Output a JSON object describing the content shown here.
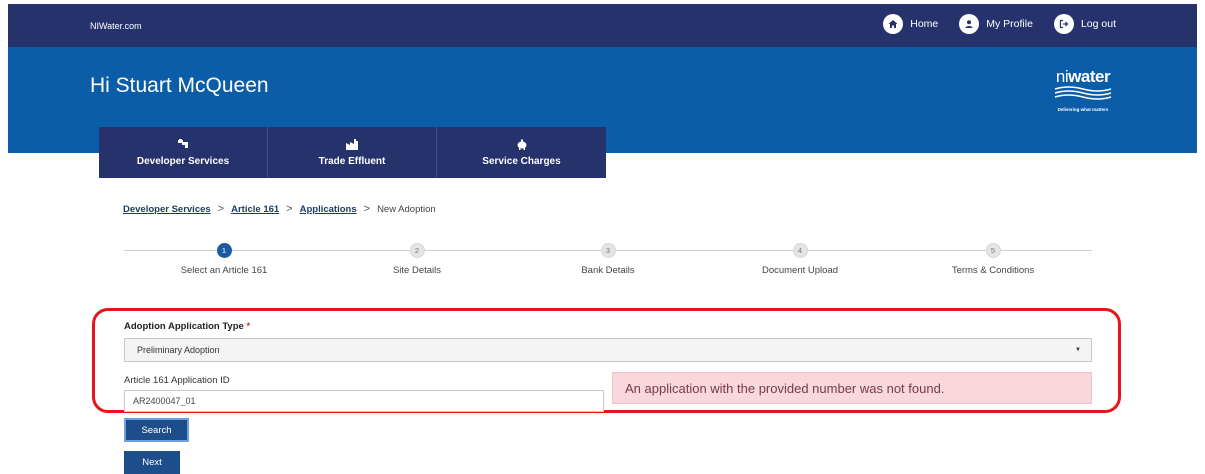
{
  "topbar": {
    "site_link": "NIWater.com",
    "nav": [
      {
        "label": "Home",
        "icon": "home-icon"
      },
      {
        "label": "My Profile",
        "icon": "user-icon"
      },
      {
        "label": "Log out",
        "icon": "logout-icon"
      }
    ],
    "color": "#26326c"
  },
  "hero": {
    "greeting": "Hi Stuart McQueen",
    "logo_word_a": "ni",
    "logo_word_b": "water",
    "logo_tagline": "Delivering what matters",
    "color": "#0b5da7"
  },
  "service_tabs": [
    {
      "label": "Developer Services",
      "icon": "tap-icon"
    },
    {
      "label": "Trade Effluent",
      "icon": "factory-icon"
    },
    {
      "label": "Service Charges",
      "icon": "piggy-bank-icon"
    }
  ],
  "breadcrumb": {
    "items": [
      "Developer Services",
      "Article 161",
      "Applications"
    ],
    "current": "New Adoption",
    "separator": ">"
  },
  "stepper": {
    "active_step": 1,
    "steps": [
      {
        "number": "1",
        "label": "Select an Article 161"
      },
      {
        "number": "2",
        "label": "Site Details"
      },
      {
        "number": "3",
        "label": "Bank Details"
      },
      {
        "number": "4",
        "label": "Document Upload"
      },
      {
        "number": "5",
        "label": "Terms & Conditions"
      }
    ]
  },
  "form": {
    "type_label": "Adoption Application Type",
    "required_marker": "*",
    "type_value": "Preliminary Adoption",
    "id_label": "Article 161 Application ID",
    "id_value": "AR2400047_01",
    "error_message": "An application with the provided number was not found.",
    "search_label": "Search",
    "next_label": "Next"
  },
  "colors": {
    "accent": "#1e4d8c",
    "highlight": "#e8141b",
    "error_bg": "#f8d8dc"
  }
}
